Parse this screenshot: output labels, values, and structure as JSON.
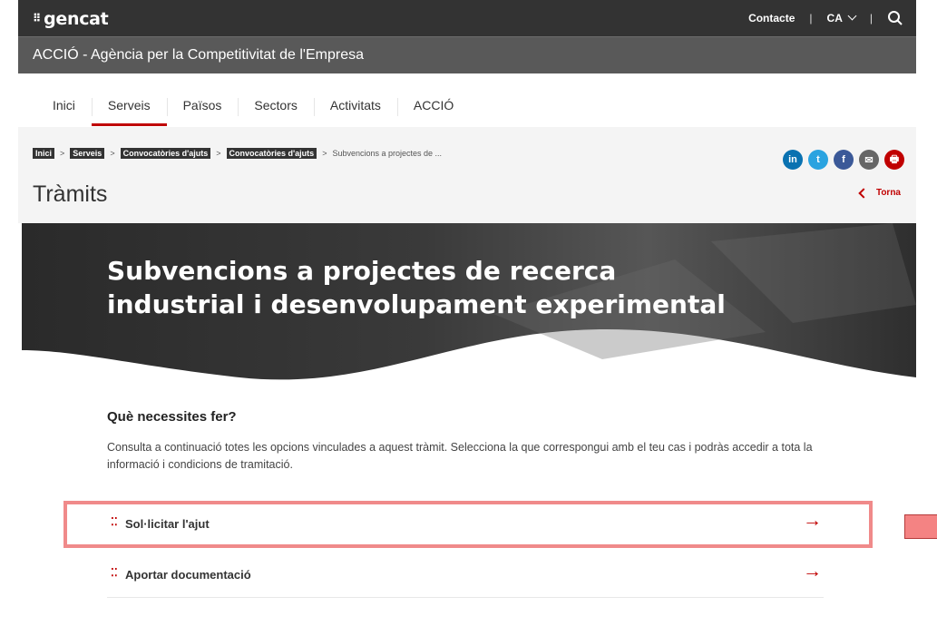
{
  "header": {
    "logo": "gencat",
    "contact": "Contacte",
    "lang": "CA",
    "agency": "ACCIÓ - Agència per la Competitivitat de l'Empresa"
  },
  "nav": {
    "items": [
      {
        "label": "Inici"
      },
      {
        "label": "Serveis"
      },
      {
        "label": "Països"
      },
      {
        "label": "Sectors"
      },
      {
        "label": "Activitats"
      },
      {
        "label": "ACCIÓ"
      }
    ],
    "active": "Serveis"
  },
  "breadcrumb": {
    "items": [
      "Inici",
      "Serveis",
      "Convocatòries d'ajuts",
      "Convocatòries d'ajuts"
    ],
    "current": "Subvencions a projectes de ..."
  },
  "page": {
    "title": "Tràmits",
    "back": "Torna"
  },
  "social": [
    "in",
    "t",
    "f",
    "✉",
    "🖶"
  ],
  "hero": {
    "title": "Subvencions a projectes de recerca industrial i desenvolupament experimental"
  },
  "section": {
    "title": "Què necessites fer?",
    "description": "Consulta a continuació totes les opcions vinculades a aquest tràmit. Selecciona la que correspongui amb el teu cas i podràs accedir a tota la informació i condicions de tramitació."
  },
  "options": [
    {
      "label": "Sol·licitar l'ajut"
    },
    {
      "label": "Aportar documentació"
    }
  ],
  "colors": {
    "accent": "#c00000",
    "topbar": "#333333",
    "subbar": "#595959",
    "highlight": "#f08a8a"
  }
}
